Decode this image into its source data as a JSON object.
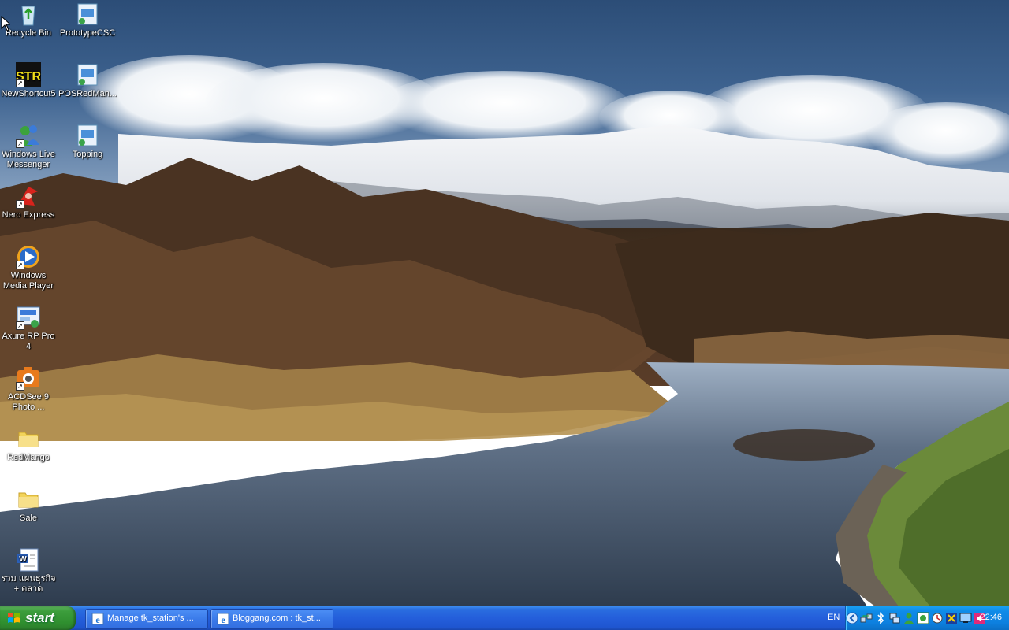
{
  "desktop": {
    "icons": [
      {
        "label": "Recycle Bin",
        "icon": "recycle-bin-icon"
      },
      {
        "label": "PrototypeCSC",
        "icon": "document-icon"
      },
      {
        "label": "NewShortcut5",
        "icon": "str-app-icon"
      },
      {
        "label": "POSRedMan...",
        "icon": "document-icon"
      },
      {
        "label": "Windows Live Messenger",
        "icon": "messenger-icon"
      },
      {
        "label": "Topping",
        "icon": "document-icon"
      },
      {
        "label": "Nero Express",
        "icon": "nero-icon"
      },
      {
        "label": "Windows Media Player",
        "icon": "media-player-icon"
      },
      {
        "label": "Axure RP Pro 4",
        "icon": "axure-icon"
      },
      {
        "label": "ACDSee 9 Photo ...",
        "icon": "acdsee-icon"
      },
      {
        "label": "RedMango",
        "icon": "folder-icon"
      },
      {
        "label": "Sale",
        "icon": "folder-icon"
      },
      {
        "label": "รวม แผนธุรกิจ + ตลาด",
        "icon": "word-document-icon"
      }
    ]
  },
  "taskbar": {
    "start_label": "start",
    "tasks": [
      {
        "label": "Manage tk_station's ...",
        "icon": "internet-explorer-icon"
      },
      {
        "label": "Bloggang.com : tk_st...",
        "icon": "internet-explorer-icon"
      }
    ],
    "language": "EN",
    "clock": "22:46",
    "tray_icons": [
      "show-hidden-icons-icon",
      "network-icon",
      "bluetooth-icon",
      "network-connection-icon",
      "user-icon",
      "messenger-icon",
      "security-icon",
      "antivirus-icon",
      "display-icon",
      "audio-icon"
    ]
  },
  "colors": {
    "taskbar": "#245edb",
    "start_button": "#3c9e3c",
    "tray": "#0f8be8"
  }
}
